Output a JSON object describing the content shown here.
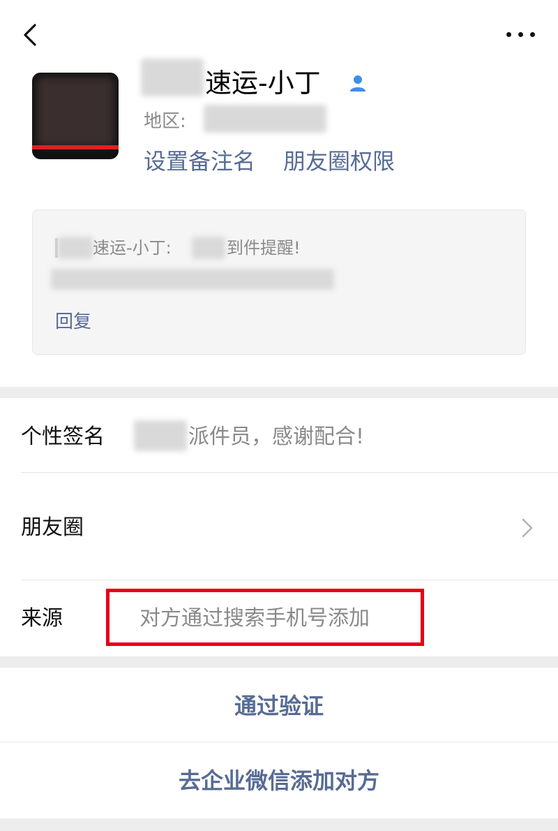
{
  "nav": {
    "back_icon": "chevron-left-icon",
    "more_icon": "more-horizontal-icon"
  },
  "profile": {
    "name": "速运-小丁",
    "verified_icon": "person-icon",
    "region_label": "地区:",
    "actions": {
      "set_remark": "设置备注名",
      "moments_permission": "朋友圈权限"
    }
  },
  "message_card": {
    "line1_part1": "速运-小丁:",
    "line1_part2": "到件提醒!",
    "reply_label": "回复"
  },
  "rows": {
    "signature": {
      "label": "个性签名",
      "value": "派件员，感谢配合!"
    },
    "moments": {
      "label": "朋友圈"
    },
    "source": {
      "label": "来源",
      "value": "对方通过搜索手机号添加"
    }
  },
  "buttons": {
    "verify": "通过验证",
    "add_via_enterprise": "去企业微信添加对方"
  },
  "colors": {
    "link": "#576b95",
    "highlight_box": "#e60012",
    "separator": "#ededed"
  }
}
